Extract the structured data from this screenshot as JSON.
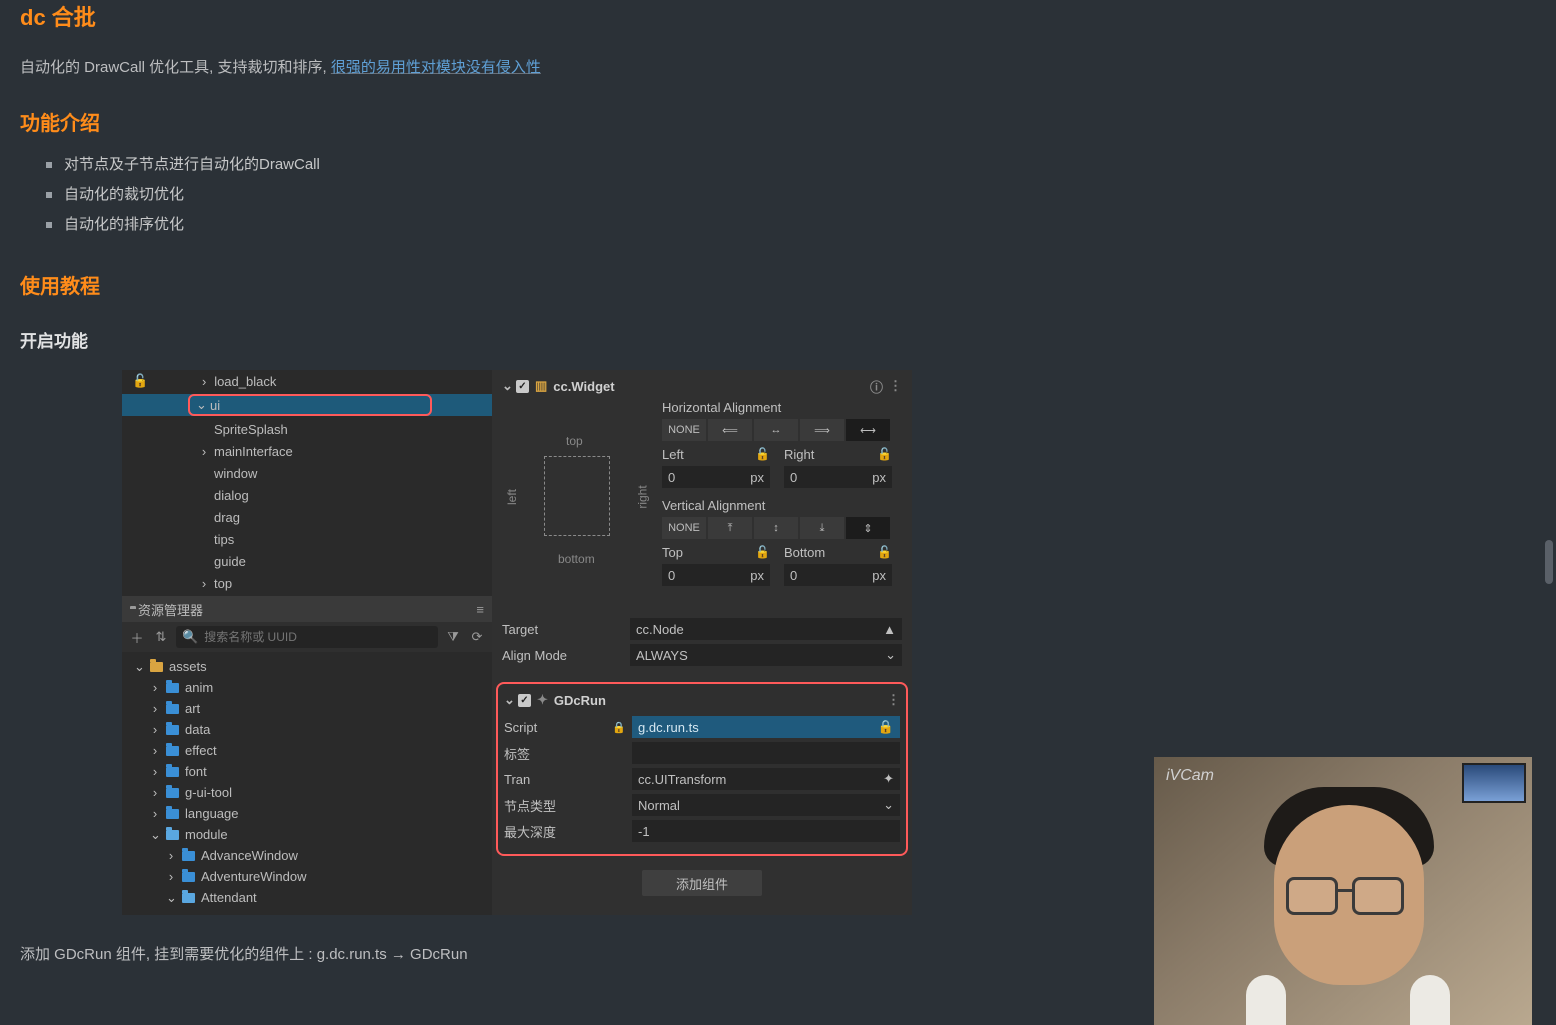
{
  "doc": {
    "h_dc": "dc 合批",
    "intro_a": "自动化的 DrawCall 优化工具, 支持裁切和排序, ",
    "intro_b": "很强的易用性对模块没有侵入性",
    "h_feat": "功能介绍",
    "feat": [
      "对节点及子节点进行自动化的DrawCall",
      "自动化的裁切优化",
      "自动化的排序优化"
    ],
    "h_tut": "使用教程",
    "h_enable": "开启功能",
    "caption": "添加 GDcRun 组件, 挂到需要优化的组件上 : g.dc.run.ts → GDcRun"
  },
  "editor": {
    "hier": {
      "load_black": "load_black",
      "ui": "ui",
      "items": [
        "SpriteSplash",
        "mainInterface",
        "window",
        "dialog",
        "drag",
        "tips",
        "guide",
        "top"
      ]
    },
    "assets": {
      "title": "资源管理器",
      "search_placeholder": "搜索名称或 UUID",
      "root": "assets",
      "folders": [
        "anim",
        "art",
        "data",
        "effect",
        "font",
        "g-ui-tool",
        "language",
        "module"
      ],
      "module_children": [
        "AdvanceWindow",
        "AdventureWindow",
        "Attendant"
      ]
    },
    "inspector": {
      "widget": "cc.Widget",
      "h_align": "Horizontal Alignment",
      "v_align": "Vertical Alignment",
      "none": "NONE",
      "left": "Left",
      "right": "Right",
      "top_l": "Top",
      "bottom_l": "Bottom",
      "zero": "0",
      "px": "px",
      "box_top": "top",
      "box_bottom": "bottom",
      "box_left": "left",
      "box_right": "right",
      "target_l": "Target",
      "target_v": "cc.Node",
      "alignmode_l": "Align Mode",
      "alignmode_v": "ALWAYS",
      "gdc": {
        "name": "GDcRun",
        "script_l": "Script",
        "script_v": "g.dc.run.ts",
        "tag_l": "标签",
        "tran_l": "Tran",
        "tran_v": "cc.UITransform",
        "nodetype_l": "节点类型",
        "nodetype_v": "Normal",
        "maxdepth_l": "最大深度",
        "maxdepth_v": "-1"
      },
      "add_comp": "添加组件"
    }
  },
  "cam": {
    "label": "iVCam"
  }
}
